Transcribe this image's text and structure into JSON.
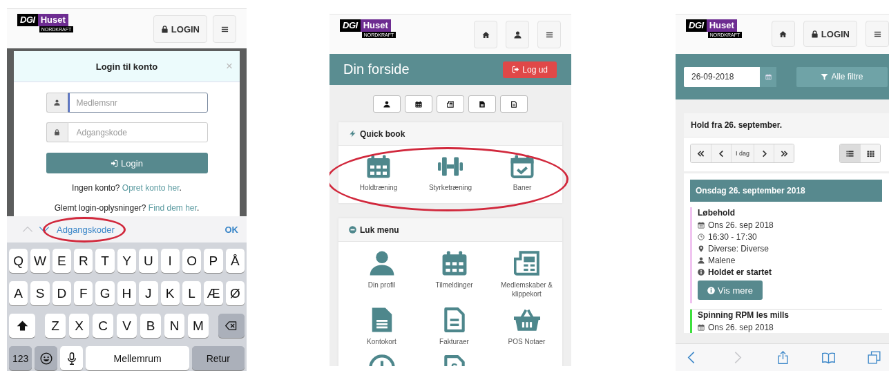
{
  "login_screen": {
    "logo": {
      "brand": "DGI",
      "name": "Huset",
      "sub": "NORDKRAFT"
    },
    "header_buttons": [
      {
        "kind": "login",
        "label": "LOGIN"
      },
      {
        "kind": "menu"
      }
    ],
    "modal": {
      "title": "Login til konto",
      "close": "×",
      "fields": [
        {
          "kind": "user",
          "placeholder": "Medlemsnr",
          "focused": true
        },
        {
          "kind": "lock",
          "placeholder": "Adgangskode",
          "focused": false
        }
      ],
      "button": "Login",
      "signup": {
        "before": "Ingen konto?",
        "link": "Opret konto her",
        "after": "."
      },
      "forgot": {
        "before": "Glemt login-oplysninger?",
        "link": "Find dem her",
        "after": "."
      }
    },
    "keyboard": {
      "arrows": [
        {
          "kind": "up",
          "disabled": true
        },
        {
          "kind": "down",
          "disabled": false
        }
      ],
      "suggestion": "Adgangskoder",
      "circled": true,
      "done": "OK",
      "rows": [
        {
          "keys": [
            "Q",
            "W",
            "E",
            "R",
            "T",
            "Y",
            "U",
            "I",
            "O",
            "P",
            "Å"
          ]
        },
        {
          "keys": [
            "A",
            "S",
            "D",
            "F",
            "G",
            "H",
            "J",
            "K",
            "L",
            "Æ",
            "Ø"
          ]
        },
        {
          "left": {
            "kind": "shift"
          },
          "keys": [
            "Z",
            "X",
            "C",
            "V",
            "B",
            "N",
            "M"
          ],
          "right": {
            "kind": "backspace"
          }
        },
        {
          "specials": [
            {
              "kind": "mode",
              "label": "123"
            },
            {
              "kind": "emoji"
            },
            {
              "kind": "mic"
            },
            {
              "kind": "space",
              "label": "Mellemrum"
            },
            {
              "kind": "return",
              "label": "Retur"
            }
          ]
        }
      ]
    }
  },
  "front_page": {
    "logo": {
      "brand": "DGI",
      "name": "Huset",
      "sub": "NORDKRAFT"
    },
    "header_buttons": [
      {
        "kind": "home"
      },
      {
        "kind": "user"
      },
      {
        "kind": "menu"
      }
    ],
    "banner": {
      "title": "Din forside",
      "logout": "Log ud"
    },
    "shortcut_buttons": [
      {
        "kind": "user"
      },
      {
        "kind": "calendar"
      },
      {
        "kind": "newspaper"
      },
      {
        "kind": "file"
      },
      {
        "kind": "file-outline"
      }
    ],
    "quick_book": {
      "title": "Quick book",
      "circled": true,
      "items": [
        {
          "kind": "calendar",
          "label": "Holdtræning"
        },
        {
          "kind": "dumbbell",
          "label": "Styrketræning"
        },
        {
          "kind": "calendar-check",
          "label": "Baner"
        }
      ]
    },
    "menu": {
      "title": "Luk menu",
      "items": [
        {
          "kind": "user",
          "label": "Din profil"
        },
        {
          "kind": "calendar",
          "label": "Tilmeldinger"
        },
        {
          "kind": "newspaper",
          "label": "Medlemskaber & klippekort"
        },
        {
          "kind": "file",
          "label": "Kontokort"
        },
        {
          "kind": "file-outline",
          "label": "Fakturaer"
        },
        {
          "kind": "basket",
          "label": "POS Notaer"
        },
        {
          "kind": "clock"
        },
        {
          "kind": "file-section"
        }
      ]
    }
  },
  "schedule": {
    "logo": {
      "brand": "DGI",
      "name": "Huset",
      "sub": "NORDKRAFT"
    },
    "header_buttons": [
      {
        "kind": "home"
      },
      {
        "kind": "login",
        "label": "LOGIN"
      },
      {
        "kind": "menu"
      }
    ],
    "date_field": {
      "value": "26-09-2018"
    },
    "filter_button": "Alle filtre",
    "heading": "Hold fra 26. september.",
    "pager": [
      {
        "kind": "first"
      },
      {
        "kind": "prev"
      },
      {
        "kind": "today",
        "label": "I dag"
      },
      {
        "kind": "next"
      },
      {
        "kind": "last"
      }
    ],
    "views": [
      {
        "kind": "list",
        "selected": true
      },
      {
        "kind": "grid",
        "selected": false
      }
    ],
    "day": {
      "title": "Onsdag 26. september 2018",
      "events": [
        {
          "name": "Løbehold",
          "color": "#f0c4f0",
          "details": [
            {
              "kind": "date",
              "text": "Ons 26. sep 2018"
            },
            {
              "kind": "time",
              "text": "16:30 - 17:30"
            },
            {
              "kind": "place",
              "text": "Diverse: Diverse"
            },
            {
              "kind": "person",
              "text": "Malene"
            },
            {
              "kind": "status",
              "text": "Holdet er startet"
            }
          ],
          "button": "Vis mere"
        },
        {
          "name": "Spinning RPM les mills",
          "color": "#3ee03e",
          "details": [
            {
              "kind": "date",
              "text": "Ons 26. sep 2018"
            }
          ]
        }
      ]
    },
    "browser_bar": [
      {
        "kind": "back",
        "disabled": false
      },
      {
        "kind": "forward",
        "disabled": true
      },
      {
        "kind": "share",
        "disabled": false
      },
      {
        "kind": "bookmarks",
        "disabled": false
      },
      {
        "kind": "tabs",
        "disabled": false
      }
    ]
  }
}
